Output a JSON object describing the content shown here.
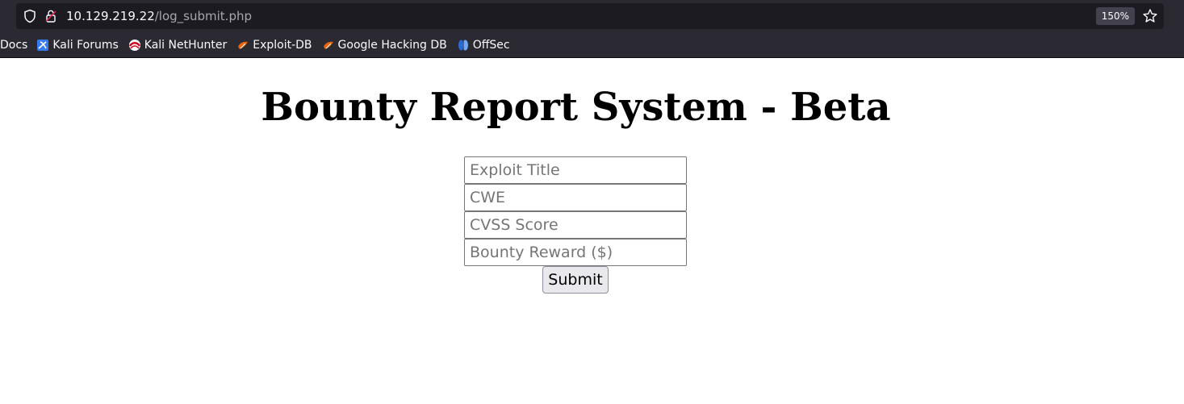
{
  "browser": {
    "url_host": "10.129.219.22",
    "url_path": "/log_submit.php",
    "zoom": "150%",
    "bookmarks": [
      {
        "label": "Docs",
        "icon": "none"
      },
      {
        "label": "Kali Forums",
        "icon": "kali-forums-icon"
      },
      {
        "label": "Kali NetHunter",
        "icon": "kali-nethunter-icon"
      },
      {
        "label": "Exploit-DB",
        "icon": "exploit-db-icon"
      },
      {
        "label": "Google Hacking DB",
        "icon": "exploit-db-icon"
      },
      {
        "label": "OffSec",
        "icon": "offsec-icon"
      }
    ]
  },
  "page": {
    "title": "Bounty Report System - Beta",
    "fields": [
      {
        "placeholder": "Exploit Title",
        "value": ""
      },
      {
        "placeholder": "CWE",
        "value": ""
      },
      {
        "placeholder": "CVSS Score",
        "value": ""
      },
      {
        "placeholder": "Bounty Reward ($)",
        "value": ""
      }
    ],
    "submit_label": "Submit"
  }
}
